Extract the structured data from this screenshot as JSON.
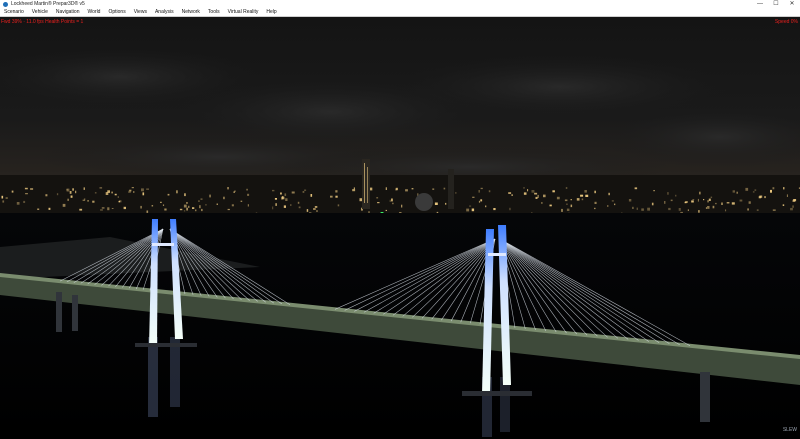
{
  "window": {
    "title": "Lockheed Martin® Prepar3D® v5",
    "minimize_glyph": "—",
    "maximize_glyph": "☐",
    "close_glyph": "✕"
  },
  "menu": {
    "items": [
      "Scenario",
      "Vehicle",
      "Navigation",
      "World",
      "Options",
      "Views",
      "Analysis",
      "Network",
      "Tools",
      "Virtual Reality",
      "Help"
    ]
  },
  "viewport": {
    "status_left": "Fwd 39% · 11.0 fps  Health Points = 1",
    "status_right": "Speed 0%",
    "heading_indicator": "SLEW"
  },
  "colors": {
    "status_text": "#e8201e",
    "bridge_tower": "#eaf4ff",
    "bridge_tower_glow": "#3a7bff",
    "city_lights": "#ffd98a",
    "night_sky": "#111111"
  }
}
